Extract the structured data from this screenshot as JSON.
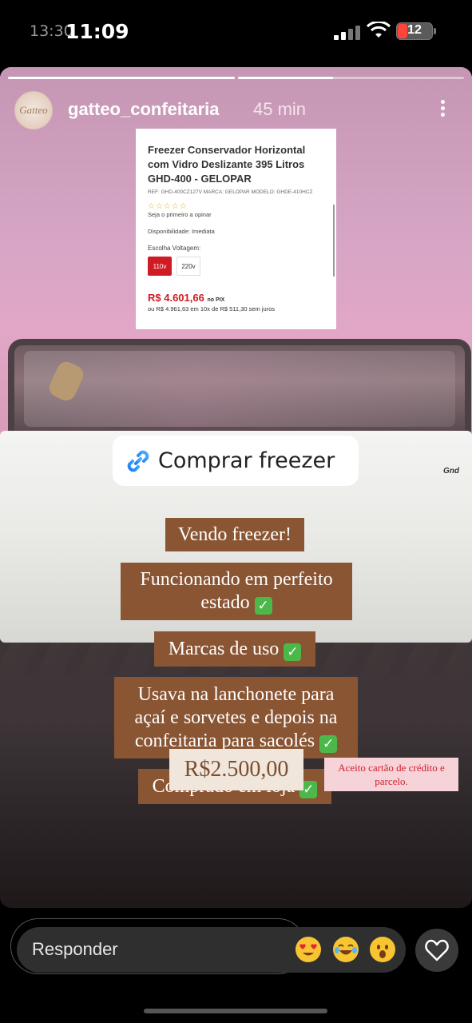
{
  "status_bar": {
    "time_ghost": "13:30",
    "time": "11:09",
    "battery": "12"
  },
  "story": {
    "progress_segments": [
      1.0,
      0.42
    ],
    "user": {
      "avatar_text": "Gatteo",
      "username": "gatteo_confeitaria",
      "time_ago": "45 min"
    }
  },
  "product_card": {
    "title": "Freezer Conservador Horizontal com Vidro Deslizante 395 Litros GHD-400 - GELOPAR",
    "ref": "REF: GHD-400CZ127V   MARCA: GELOPAR  MODELO: GHDE-410HCZ",
    "stars": "☆☆☆☆☆",
    "first_review": "Seja o primeiro a opinar",
    "availability": "Disponibilidade: Imediata",
    "voltage_label": "Escolha Voltagem:",
    "voltage_selected": "110v",
    "voltage_other": "220v",
    "price": "R$ 4.601,66",
    "price_suffix": "no PIX",
    "installments": "ou R$ 4.961,63 em 10x de R$ 511,30 sem juros"
  },
  "link_sticker": {
    "label": "Comprar freezer",
    "icon": "link-icon"
  },
  "captions": {
    "c1": "Vendo freezer!",
    "c2a": "Funcionando em perfeito",
    "c2b": "estado",
    "c3": "Marcas de uso",
    "c4a": "Usava na lanchonete para",
    "c4b": "açaí e sorvetes e depois na",
    "c4c": "confeitaria para sacolés",
    "c5": "Comprado em loja",
    "check": "✓",
    "price": "R$2.500,00",
    "credit": "Aceito cartão de crédito e parcelo."
  },
  "reply": {
    "placeholder": "Responder",
    "emojis": [
      "heart-eyes-emoji",
      "laughing-emoji",
      "surprised-emoji"
    ],
    "like_icon": "heart-icon"
  },
  "colors": {
    "caption_bg": "#8a5533",
    "price_red": "#d01b24",
    "check_green": "#4cb84a"
  }
}
